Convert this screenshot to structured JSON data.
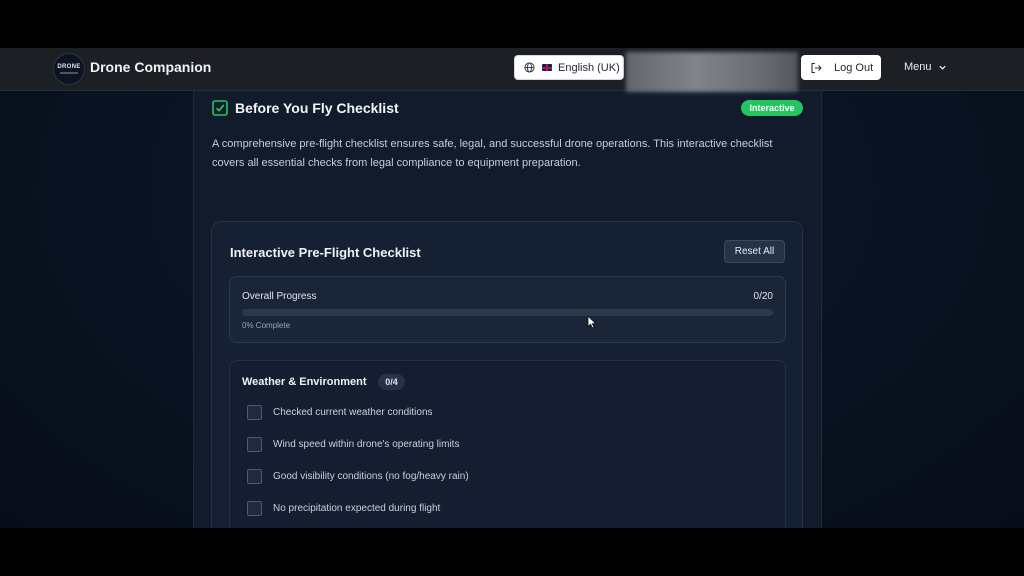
{
  "navbar": {
    "logo_text": "DRONE",
    "brand": "Drone Companion",
    "language_label": "English (UK)",
    "logout_label": "Log Out",
    "menu_label": "Menu"
  },
  "card": {
    "title": "Before You Fly Checklist",
    "badge": "Interactive",
    "description": "A comprehensive pre-flight checklist ensures safe, legal, and successful drone operations. This interactive checklist covers all essential checks from legal compliance to equipment preparation."
  },
  "checklist": {
    "title": "Interactive Pre-Flight Checklist",
    "reset_label": "Reset All",
    "progress": {
      "label": "Overall Progress",
      "count": "0/20",
      "percent_text": "0% Complete",
      "fraction": 0
    },
    "sections": [
      {
        "title": "Weather & Environment",
        "count": "0/4",
        "items": [
          "Checked current weather conditions",
          "Wind speed within drone's operating limits",
          "Good visibility conditions (no fog/heavy rain)",
          "No precipitation expected during flight"
        ]
      }
    ]
  },
  "colors": {
    "accent_green": "#22c55e",
    "navbar_bg": "#1c1f24",
    "card_bg": "#111b2b"
  },
  "icons": {
    "title_icon": "checkbox-checked-icon",
    "language_icon": "globe-icon",
    "flag_icon": "uk-flag-icon",
    "logout_icon": "logout-icon",
    "menu_icon": "chevron-down-icon"
  }
}
